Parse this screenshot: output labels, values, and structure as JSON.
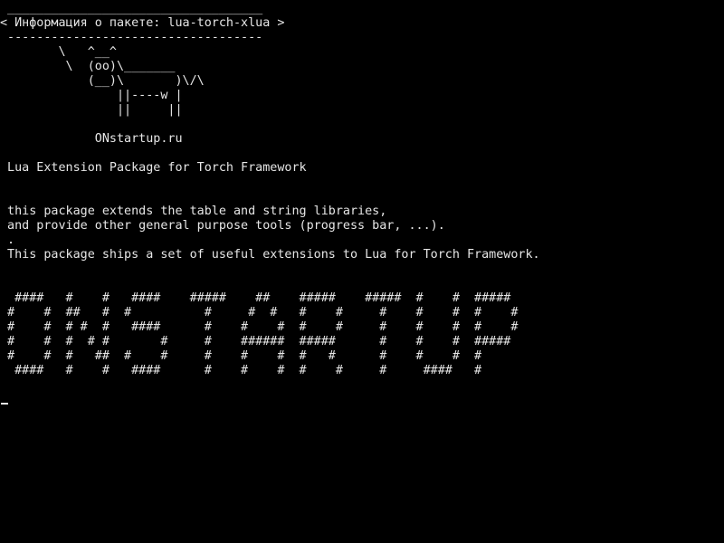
{
  "speech_bubble": {
    "top_border": " ___________________________________",
    "title": "< Информация о пакете: lua-torch-xlua >",
    "bottom_border": " -----------------------------------"
  },
  "cow_art": [
    "        \\   ^__^",
    "         \\  (oo)\\_______",
    "            (__)\\       )\\/\\",
    "                ||----w |",
    "                ||     ||"
  ],
  "site_label": "             ONstartup.ru",
  "package_heading": " Lua Extension Package for Torch Framework",
  "description_lines": [
    " this package extends the table and string libraries,",
    " and provide other general purpose tools (progress bar, ...).",
    " .",
    " This package ships a set of useful extensions to Lua for Torch Framework."
  ],
  "banner_art": [
    "  ####   #    #   ####    #####    ##    #####    #####  #    #  #####",
    " #    #  ##   #  #          #     #  #   #    #     #    #    #  #    #",
    " #    #  # #  #   ####      #    #    #  #    #     #    #    #  #    #",
    " #    #  #  # #       #     #    ######  #####      #    #    #  #####",
    " #    #  #   ##  #    #     #    #    #  #   #      #    #    #  #",
    "  ####   #    #   ####      #    #    #  #    #     #     ####   #"
  ]
}
